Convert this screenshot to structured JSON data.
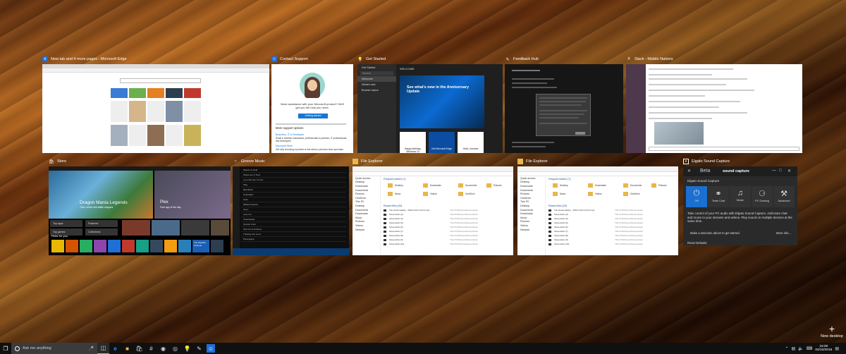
{
  "windows": [
    {
      "title": "New tab and 4 more pages - Microsoft Edge",
      "icon": "edge-icon",
      "icon_color": "#1e6fd6"
    },
    {
      "title": "Contact Support",
      "icon": "person-icon",
      "icon_color": "#1e6fd6"
    },
    {
      "title": "Get Started",
      "icon": "lightbulb-icon",
      "icon_color": "#000000"
    },
    {
      "title": "Feedback Hub",
      "icon": "feedback-icon",
      "icon_color": "#000000"
    },
    {
      "title": "Slack - Mobile Nations",
      "icon": "slack-icon",
      "icon_color": "#ffffff"
    },
    {
      "title": "Store",
      "icon": "store-icon",
      "icon_color": "#000000"
    },
    {
      "title": "Groove Music",
      "icon": "groove-icon",
      "icon_color": "#000000"
    },
    {
      "title": "File Explorer",
      "icon": "folder-icon",
      "icon_color": "#e8b64a"
    },
    {
      "title": "File Explorer",
      "icon": "folder-icon",
      "icon_color": "#e8b64a"
    },
    {
      "title": "Elgato Sound Capture",
      "icon": "elgato-icon",
      "icon_color": "#ffffff"
    }
  ],
  "contact_support": {
    "prompt": "Need assistance with your Microsoft product? We'll get you the help you need.",
    "button": "Getting started",
    "more_options": "More support options",
    "business_link": "Business, IT & Developer",
    "business_desc": "Small & medium businesses, professionals & partners, IT professionals and developers",
    "store_link": "Microsoft Store",
    "store_desc": "Get help choosing a product or ask about a previous store purchase"
  },
  "get_started": {
    "app": "Get Started",
    "menu": [
      "Welcome",
      "What's new",
      "Browse topics",
      "Search"
    ],
    "header": "WELCOME",
    "hero": "See what's new in the Anniversary Update",
    "card1": "Happy birthday, Windows 10",
    "card2": "Get Microsoft Edge",
    "card3": "Hello, humans"
  },
  "store": {
    "hero_title": "Dragon Mania Legends",
    "hero_sub": "Train, breed and battle dragons",
    "right_title": "Plex",
    "right_sub": "Free app of the day",
    "buttons": [
      "Top apps",
      "Featured",
      "Top games",
      "Collections"
    ],
    "picks_label": "Picks for you",
    "weather_tile": "The Weather Channel"
  },
  "groove": {
    "rows": [
      "Silence Is Gold",
      "Where Are Ü Now",
      "Love Me Like You Do",
      "Stay",
      "Bad Blood",
      "Chandelier",
      "Hello",
      "Wildest Dreams",
      "Sorry",
      "Lean On",
      "Cheerleader",
      "Uptown Funk",
      "Shut Up and Dance",
      "Thinking Out Loud",
      "Photograph"
    ]
  },
  "file_explorer": {
    "frequent": "Frequent folders (7)",
    "recent": "Recent files (20)",
    "nav": [
      "Quick access",
      "Desktop",
      "Downloads",
      "Documents",
      "Pictures",
      "OneDrive",
      "This PC",
      "Desktop",
      "Documents",
      "Downloads",
      "Music",
      "Pictures",
      "Videos",
      "Network"
    ],
    "folders": [
      "Desktop",
      "Downloads",
      "Documents",
      "Pictures",
      "Music",
      "Videos",
      "OneDrive"
    ],
    "files": [
      "The Great Gatsby - 2016-10-04 13-16.mp4",
      "Screenshot (3)",
      "Screenshot (4)",
      "Screenshot (5)",
      "Screenshot (6)",
      "Screenshot (7)",
      "Screenshot (8)",
      "Screenshot (9)",
      "Screenshot (10)"
    ],
    "location": "This PC\\Pictures\\Screenshots"
  },
  "elgato": {
    "beta": "Beta",
    "brand": "sound capture",
    "subtitle": "Elgato Sound Capture",
    "tiles": [
      "Off",
      "Team Chat",
      "Music",
      "PC Gaming",
      "Advanced"
    ],
    "description": "Take control of your PC audio with Elgato Sound Capture. Add team chat and music to your streams and videos. Play sound on multiple devices at the same time.",
    "hint": "Make a selection above to get started.",
    "more": "More info...",
    "reset": "Reset Defaults"
  },
  "new_desktop": {
    "label": "New desktop"
  },
  "taskbar": {
    "search_placeholder": "Ask me anything",
    "time": "15:00",
    "date": "04/10/2016"
  }
}
